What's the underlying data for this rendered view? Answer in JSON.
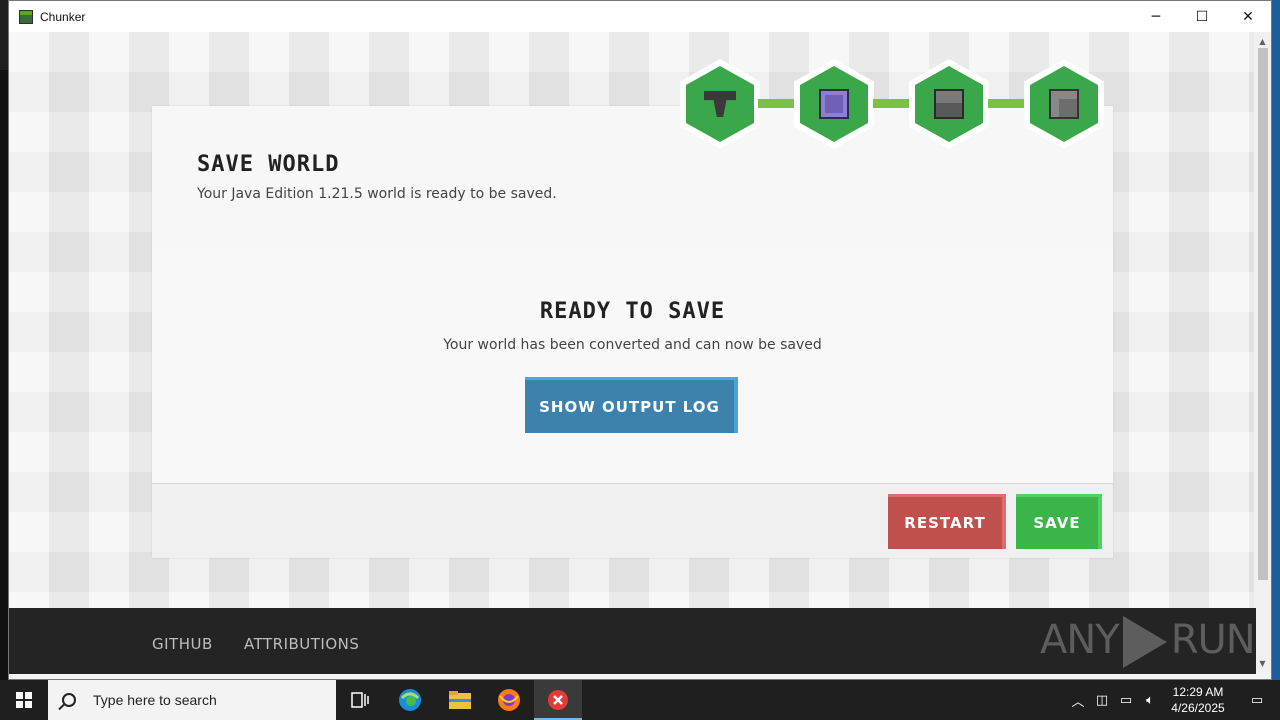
{
  "window": {
    "title": "Chunker",
    "minimize": "─",
    "maximize": "☐",
    "close": "✕"
  },
  "card": {
    "title": "SAVE WORLD",
    "subtitle": "Your Java Edition 1.21.5 world is ready to be saved.",
    "ready_title": "READY TO SAVE",
    "ready_subtitle": "Your world has been converted and can now be saved",
    "show_log_label": "SHOW OUTPUT LOG",
    "restart_label": "RESTART",
    "save_label": "SAVE"
  },
  "stepper": {
    "steps": [
      {
        "icon": "hopper-icon",
        "status": "complete"
      },
      {
        "icon": "command-block-icon",
        "status": "complete"
      },
      {
        "icon": "furnace-icon",
        "status": "complete"
      },
      {
        "icon": "dispenser-icon",
        "status": "complete"
      }
    ],
    "color_complete": "#3aa74a",
    "color_connector": "#7cc142"
  },
  "footer": {
    "links": [
      "GITHUB",
      "ATTRIBUTIONS"
    ],
    "watermark_left": "ANY",
    "watermark_right": "RUN"
  },
  "taskbar": {
    "search_placeholder": "Type here to search",
    "time": "12:29 AM",
    "date": "4/26/2025",
    "apps": [
      "task-view-icon",
      "edge-icon",
      "file-explorer-icon",
      "firefox-icon",
      "chunker-app-icon"
    ]
  },
  "colors": {
    "log_button": "#3d82ad",
    "restart_button": "#c0504d",
    "save_button": "#3bb54a",
    "footer_bg": "#242424"
  }
}
